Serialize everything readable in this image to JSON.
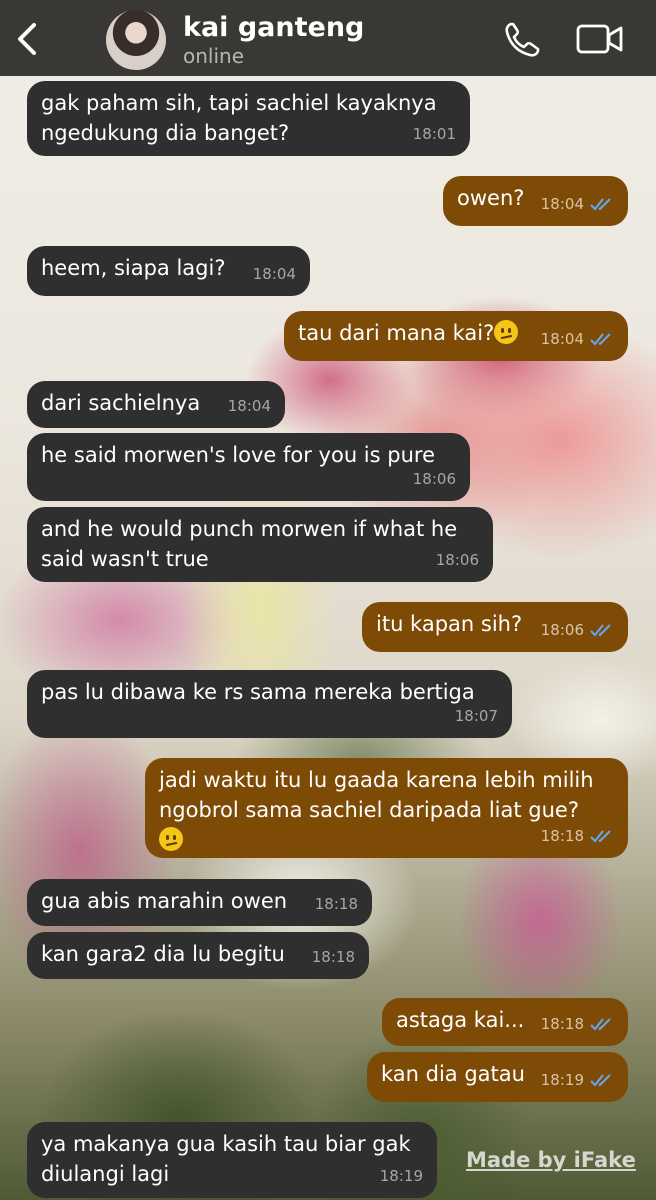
{
  "header": {
    "back_icon": "chevron-left-icon",
    "contact_name": "kai ganteng",
    "status": "online",
    "call_icon": "phone-icon",
    "video_icon": "video-camera-icon",
    "bar_color": "#393834"
  },
  "colors": {
    "incoming_bubble": "#2f2f2f",
    "outgoing_bubble": "#7e4b06",
    "read_ticks": "#63a9f2"
  },
  "messages": [
    {
      "direction": "in",
      "text": "gak paham sih, tapi sachiel kayaknya\nngedukung dia banget?",
      "time": "18:01"
    },
    {
      "direction": "out",
      "text": "owen?",
      "time": "18:04",
      "read": true
    },
    {
      "direction": "in",
      "text": "heem, siapa lagi?",
      "time": "18:04"
    },
    {
      "direction": "out",
      "text": "tau dari mana kai?",
      "emoji": "confused-face",
      "time": "18:04",
      "read": true
    },
    {
      "direction": "in",
      "text": "dari sachielnya",
      "time": "18:04"
    },
    {
      "direction": "in",
      "text": "he said morwen's love for you is pure",
      "time": "18:06"
    },
    {
      "direction": "in",
      "text": "and he would punch morwen if what he\nsaid wasn't true",
      "time": "18:06"
    },
    {
      "direction": "out",
      "text": "itu kapan sih?",
      "time": "18:06",
      "read": true
    },
    {
      "direction": "in",
      "text": "pas lu dibawa ke rs sama mereka bertiga",
      "time": "18:07"
    },
    {
      "direction": "out",
      "text": "jadi waktu itu lu gaada karena lebih milih\nngobrol sama sachiel daripada liat gue?",
      "emoji": "confused-face",
      "time": "18:18",
      "read": true
    },
    {
      "direction": "in",
      "text": "gua abis marahin owen",
      "time": "18:18"
    },
    {
      "direction": "in",
      "text": "kan gara2 dia lu begitu",
      "time": "18:18"
    },
    {
      "direction": "out",
      "text": "astaga kai...",
      "time": "18:18",
      "read": true
    },
    {
      "direction": "out",
      "text": "kan dia gatau",
      "time": "18:19",
      "read": true
    },
    {
      "direction": "in",
      "text": "ya makanya gua kasih tau biar gak\ndiulangi lagi",
      "time": "18:19"
    }
  ],
  "watermark": "Made by iFake"
}
